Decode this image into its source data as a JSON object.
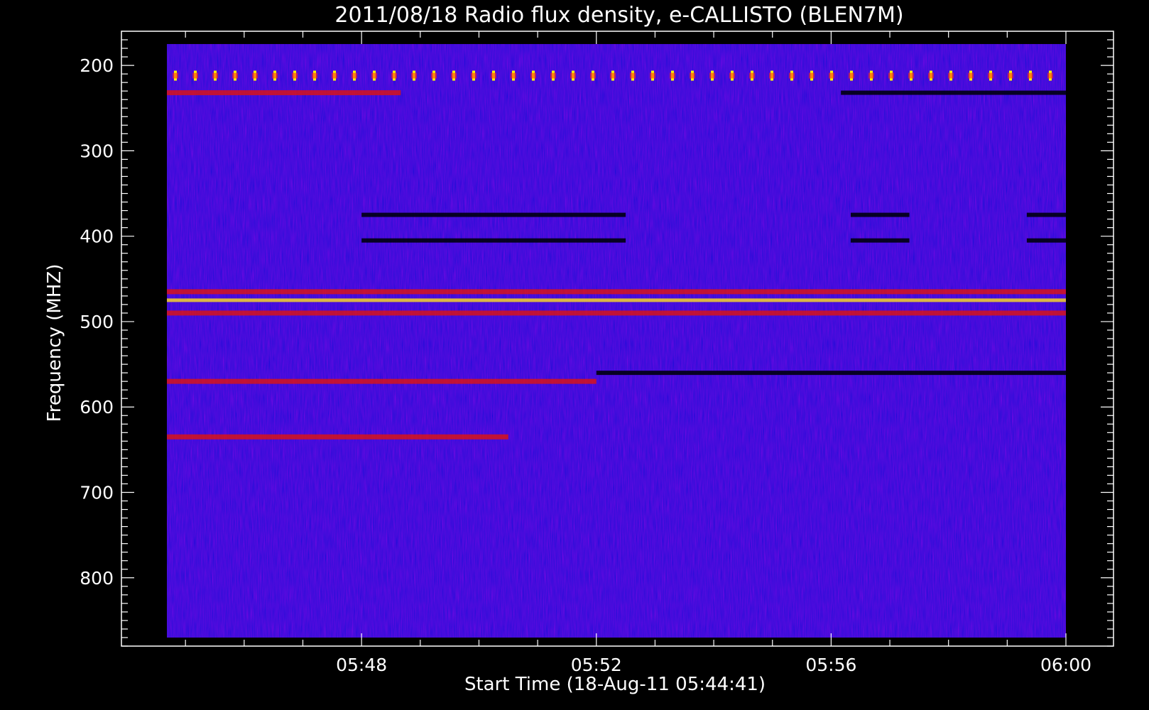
{
  "chart_data": {
    "type": "heatmap",
    "title": "2011/08/18  Radio flux density, e-CALLISTO (BLEN7M)",
    "xlabel": "Start Time (18-Aug-11 05:44:41)",
    "ylabel": "Frequency (MHZ)",
    "x_range": [
      "05:44:41",
      "06:00:00"
    ],
    "ylim": [
      880,
      160
    ],
    "data_y_range": [
      175,
      870
    ],
    "x_ticks": [
      "05:48",
      "05:52",
      "05:56",
      "06:00"
    ],
    "y_ticks": [
      200,
      300,
      400,
      500,
      600,
      700,
      800
    ],
    "colormap": [
      "#000000",
      "#0000ff",
      "#ff0000",
      "#ffff00",
      "#ffffff"
    ],
    "background": "#000000",
    "grid": false,
    "features": [
      {
        "kind": "periodic_spikes",
        "freq_mhz": 212,
        "color": "#ffff00"
      },
      {
        "kind": "band",
        "freq_mhz": 232,
        "intensity": "red",
        "time_span": [
          "05:44:41",
          "05:48:40"
        ]
      },
      {
        "kind": "band",
        "freq_mhz": 232,
        "intensity": "black",
        "time_span": [
          "05:56:10",
          "06:00:00"
        ]
      },
      {
        "kind": "band",
        "freq_mhz": 475,
        "intensity": "yellow",
        "time_span": [
          "05:44:41",
          "06:00:00"
        ]
      },
      {
        "kind": "band",
        "freq_mhz": 465,
        "intensity": "red",
        "time_span": [
          "05:44:41",
          "06:00:00"
        ]
      },
      {
        "kind": "band",
        "freq_mhz": 490,
        "intensity": "red",
        "time_span": [
          "05:44:41",
          "06:00:00"
        ]
      },
      {
        "kind": "band",
        "freq_mhz": 570,
        "intensity": "red",
        "time_span": [
          "05:44:41",
          "05:52:00"
        ]
      },
      {
        "kind": "band",
        "freq_mhz": 635,
        "intensity": "red",
        "time_span": [
          "05:44:41",
          "05:50:30"
        ]
      },
      {
        "kind": "band",
        "freq_mhz": 560,
        "intensity": "black",
        "time_span": [
          "05:52:00",
          "06:00:00"
        ]
      },
      {
        "kind": "band",
        "freq_mhz": 375,
        "intensity": "black",
        "time_span": [
          "05:48:00",
          "05:52:30"
        ]
      },
      {
        "kind": "band",
        "freq_mhz": 405,
        "intensity": "black",
        "time_span": [
          "05:48:00",
          "05:52:30"
        ]
      },
      {
        "kind": "band",
        "freq_mhz": 375,
        "intensity": "black",
        "time_span": [
          "05:56:20",
          "05:57:20"
        ]
      },
      {
        "kind": "band",
        "freq_mhz": 405,
        "intensity": "black",
        "time_span": [
          "05:56:20",
          "05:57:20"
        ]
      },
      {
        "kind": "band",
        "freq_mhz": 375,
        "intensity": "black",
        "time_span": [
          "05:59:20",
          "06:00:00"
        ]
      },
      {
        "kind": "band",
        "freq_mhz": 405,
        "intensity": "black",
        "time_span": [
          "05:59:20",
          "06:00:00"
        ]
      }
    ]
  }
}
